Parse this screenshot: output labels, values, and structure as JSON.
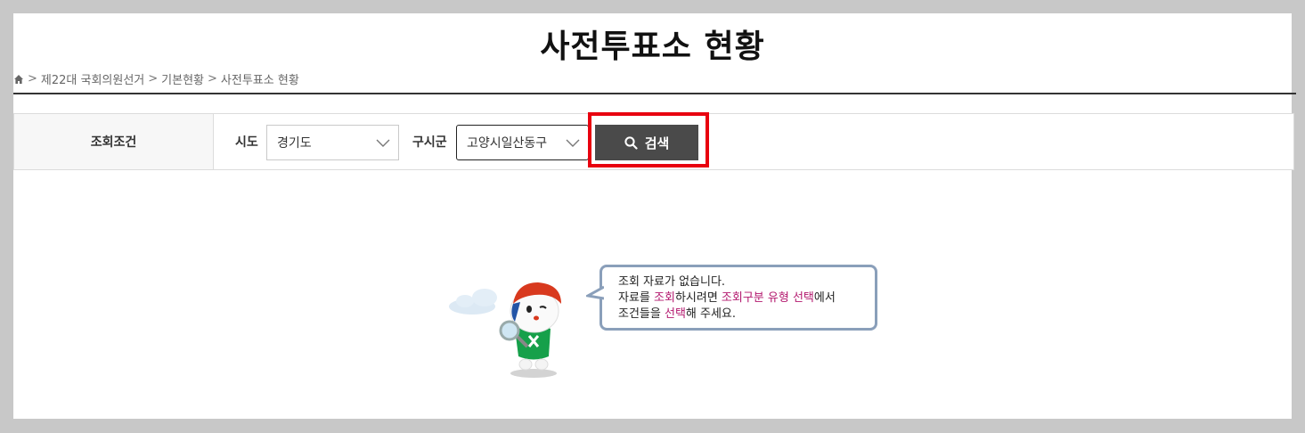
{
  "page": {
    "title": "사전투표소 현황"
  },
  "breadcrumb": {
    "home_icon": "home-icon",
    "separator": ">",
    "items": [
      "제22대 국회의원선거",
      "기본현황",
      "사전투표소 현황"
    ]
  },
  "search": {
    "condition_label": "조회조건",
    "sido_label": "시도",
    "sido_value": "경기도",
    "gusigun_label": "구시군",
    "gusigun_value": "고양시일산동구",
    "search_button_label": "검색",
    "search_icon": "search-icon"
  },
  "empty_state": {
    "line1": "조회 자료가 없습니다.",
    "line2_part1": "자료를 ",
    "line2_hl1": "조회",
    "line2_part2": "하시려면 ",
    "line2_hl2": "조회구분 유형 선택",
    "line2_part3": "에서",
    "line3_part1": "조건들을 ",
    "line3_hl1": "선택",
    "line3_part2": "해 주세요."
  },
  "colors": {
    "highlight_box": "#e8000f",
    "button_bg": "#4a4a4a",
    "emphasis_text": "#b3186e",
    "bubble_border": "#8a9fba"
  }
}
